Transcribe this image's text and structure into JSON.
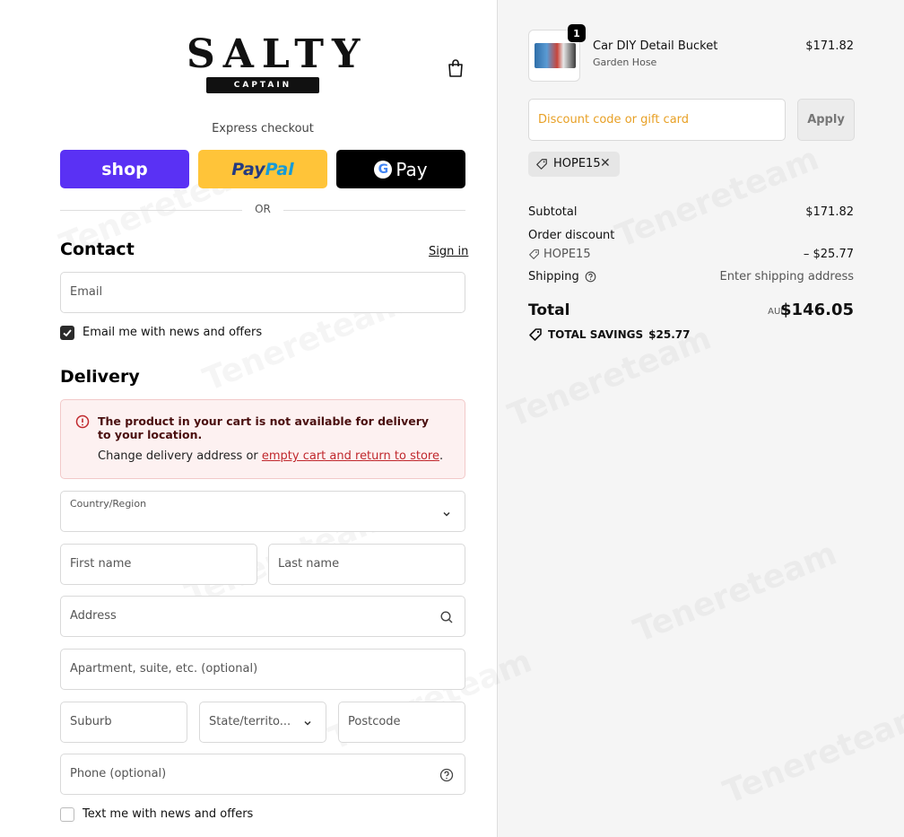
{
  "brand": {
    "logo_text": "SALTY",
    "logo_ribbon": "CAPTAIN"
  },
  "express": {
    "label": "Express checkout",
    "shop_label": "shop",
    "paypal_label_1": "Pay",
    "paypal_label_2": "Pal",
    "gpay_g": "G",
    "gpay_label": "Pay",
    "or_label": "OR"
  },
  "contact": {
    "title": "Contact",
    "signin_label": "Sign in",
    "email_placeholder": "Email",
    "news_label": "Email me with news and offers",
    "news_checked": true
  },
  "delivery": {
    "title": "Delivery",
    "alert_title": "The product in your cart is not available for delivery to your location.",
    "alert_body_prefix": "Change delivery address or ",
    "alert_link": "empty cart and return to store",
    "alert_body_suffix": ".",
    "country_label": "Country/Region",
    "first_name": "First name",
    "last_name": "Last name",
    "address": "Address",
    "apartment": "Apartment, suite, etc. (optional)",
    "suburb": "Suburb",
    "state": "State/territo...",
    "postcode": "Postcode",
    "phone": "Phone (optional)",
    "text_news_label": "Text me with news and offers",
    "text_news_checked": false
  },
  "cart": {
    "quantity": "1",
    "product_name": "Car DIY Detail Bucket",
    "product_variant": "Garden Hose",
    "product_price": "$171.82"
  },
  "discount": {
    "placeholder": "Discount code or gift card",
    "apply_label": "Apply",
    "applied_code": "HOPE15",
    "remove_glyph": "✕"
  },
  "summary": {
    "subtotal_label": "Subtotal",
    "subtotal_value": "$171.82",
    "order_discount_label": "Order discount",
    "discount_code": "HOPE15",
    "discount_value": "– $25.77",
    "shipping_label": "Shipping",
    "shipping_value": "Enter shipping address",
    "total_label": "Total",
    "currency": "AUD",
    "total_value": "$146.05",
    "savings_label": "TOTAL SAVINGS",
    "savings_value": "$25.77"
  },
  "watermark": "Tenereteam",
  "colors": {
    "shop": "#5a31f4",
    "paypal": "#ffc439",
    "alert_bg": "#fdf1f1",
    "link_red": "#c0282d",
    "discount_placeholder": "#e8a025"
  },
  "icons": [
    "bag-icon",
    "check-icon",
    "alert-icon",
    "chevron-down-icon",
    "search-icon",
    "help-circle-icon",
    "tag-icon",
    "close-icon"
  ]
}
